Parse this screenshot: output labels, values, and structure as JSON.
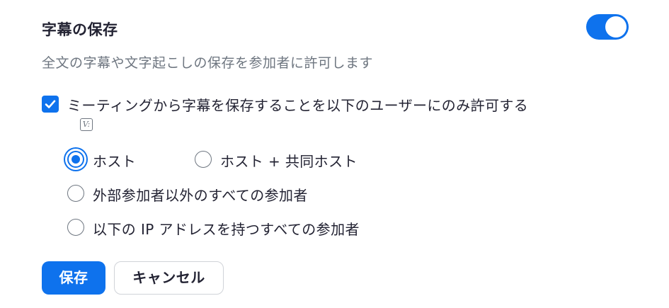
{
  "setting": {
    "title": "字幕の保存",
    "enabled": true,
    "description": "全文の字幕や文字起こしの保存を参加者に許可します"
  },
  "restriction": {
    "checked": true,
    "label": "ミーティングから字幕を保存することを以下のユーザーにのみ許可する",
    "info_icon_text": "V:"
  },
  "options": [
    {
      "label": "ホスト",
      "selected": true
    },
    {
      "label": "ホスト + 共同ホスト",
      "selected": false
    },
    {
      "label": "外部参加者以外のすべての参加者",
      "selected": false
    },
    {
      "label": "以下の IP アドレスを持つすべての参加者",
      "selected": false
    }
  ],
  "buttons": {
    "save": "保存",
    "cancel": "キャンセル"
  },
  "colors": {
    "accent": "#0e72ed",
    "text": "#232333",
    "muted": "#6e7680"
  }
}
